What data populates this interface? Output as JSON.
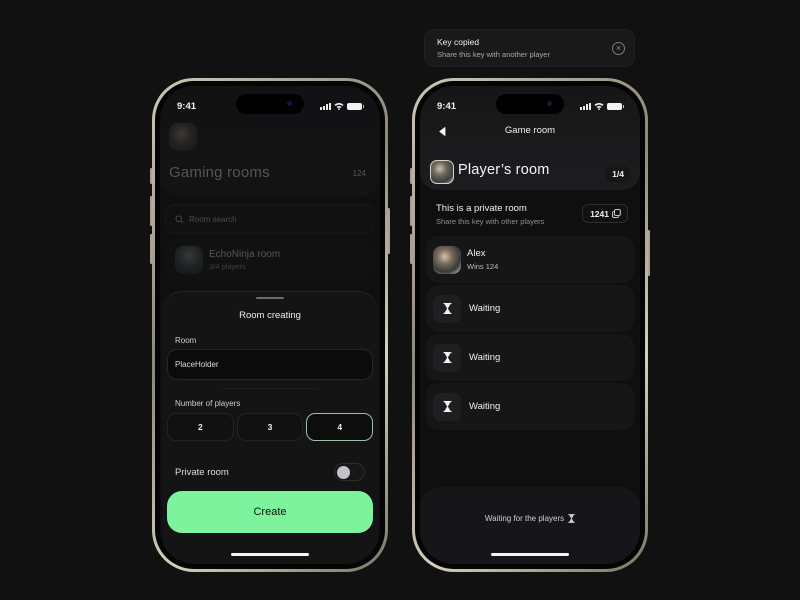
{
  "status_bar": {
    "time": "9:41"
  },
  "left_screen": {
    "background": {
      "title": "Gaming rooms",
      "count": "124",
      "search_placeholder": "Room search",
      "room": {
        "name": "EchoNinja room",
        "players": "3/4 players"
      }
    },
    "sheet": {
      "title": "Room creating",
      "room_label": "Room",
      "room_value": "PlaceHolder",
      "players_label": "Number of players",
      "player_options": [
        "2",
        "3",
        "4"
      ],
      "selected_players": "4",
      "private_label": "Private room",
      "private_enabled": false,
      "create_label": "Create"
    }
  },
  "toast": {
    "title": "Key copied",
    "message": "Share this key with another player"
  },
  "right_screen": {
    "nav_title": "Game room",
    "room_title": "Player’s room",
    "room_count": "1/4",
    "private_title": "This is a private room",
    "private_sub": "Share this key with other players",
    "room_key": "1241",
    "players": [
      {
        "name": "Alex",
        "sub": "Wins 124",
        "status": "joined"
      },
      {
        "name": "Waiting",
        "status": "waiting"
      },
      {
        "name": "Waiting",
        "status": "waiting"
      },
      {
        "name": "Waiting",
        "status": "waiting"
      }
    ],
    "footer_text": "Waiting for the players"
  },
  "colors": {
    "accent_green": "#7ef39e",
    "selected_outline": "#9cc0a4",
    "background": "#111112"
  }
}
